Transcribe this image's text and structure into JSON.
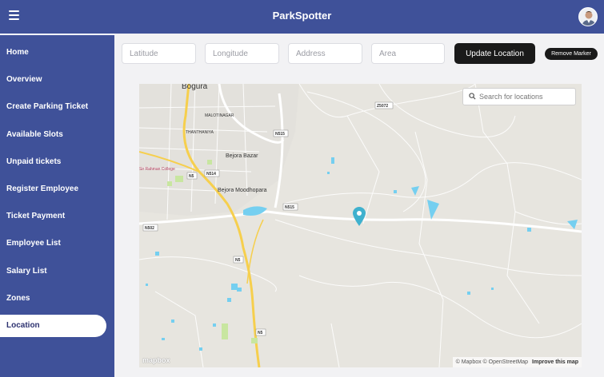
{
  "header": {
    "title": "ParkSpotter",
    "menu_icon": "hamburger-menu-icon",
    "avatar": "user-avatar"
  },
  "sidebar": {
    "items": [
      {
        "label": "Home"
      },
      {
        "label": "Overview"
      },
      {
        "label": "Create Parking Ticket"
      },
      {
        "label": "Available Slots"
      },
      {
        "label": "Unpaid tickets"
      },
      {
        "label": "Register Employee"
      },
      {
        "label": "Ticket Payment"
      },
      {
        "label": "Employee List"
      },
      {
        "label": "Salary List"
      },
      {
        "label": "Zones"
      },
      {
        "label": "Location",
        "active": true
      }
    ]
  },
  "toolbar": {
    "latitude_placeholder": "Latitude",
    "longitude_placeholder": "Longitude",
    "address_placeholder": "Address",
    "area_placeholder": "Area",
    "update_label": "Update Location",
    "remove_label": "Remove Marker"
  },
  "map": {
    "search_placeholder": "Search for locations",
    "search_icon": "search-icon",
    "marker_icon": "map-marker-icon",
    "logo": "mapbox",
    "attribution": "© Mapbox © OpenStreetMap",
    "improve_label": "Improve this map",
    "labels": {
      "city": "Bogura",
      "thanthania": "THANTHANIYA",
      "malotinagar": "MALOTINAGAR",
      "bejora_bazar": "Bejora Bazar",
      "bejora_moodhopara": "Bejora Moodhopara",
      "college": "Sir Rahman College"
    },
    "road_labels": {
      "r1": "N515",
      "r2": "N5",
      "r3": "N514",
      "r4": "N502",
      "r5": "N5",
      "r6": "N5",
      "r7": "Z5072"
    }
  },
  "colors": {
    "primary": "#3f5199",
    "button_dark": "#1a1a1a",
    "map_water": "#75cff0",
    "map_park": "#c8e6a0",
    "map_road_major": "#f6cf4d",
    "marker": "#3fb1ce"
  }
}
